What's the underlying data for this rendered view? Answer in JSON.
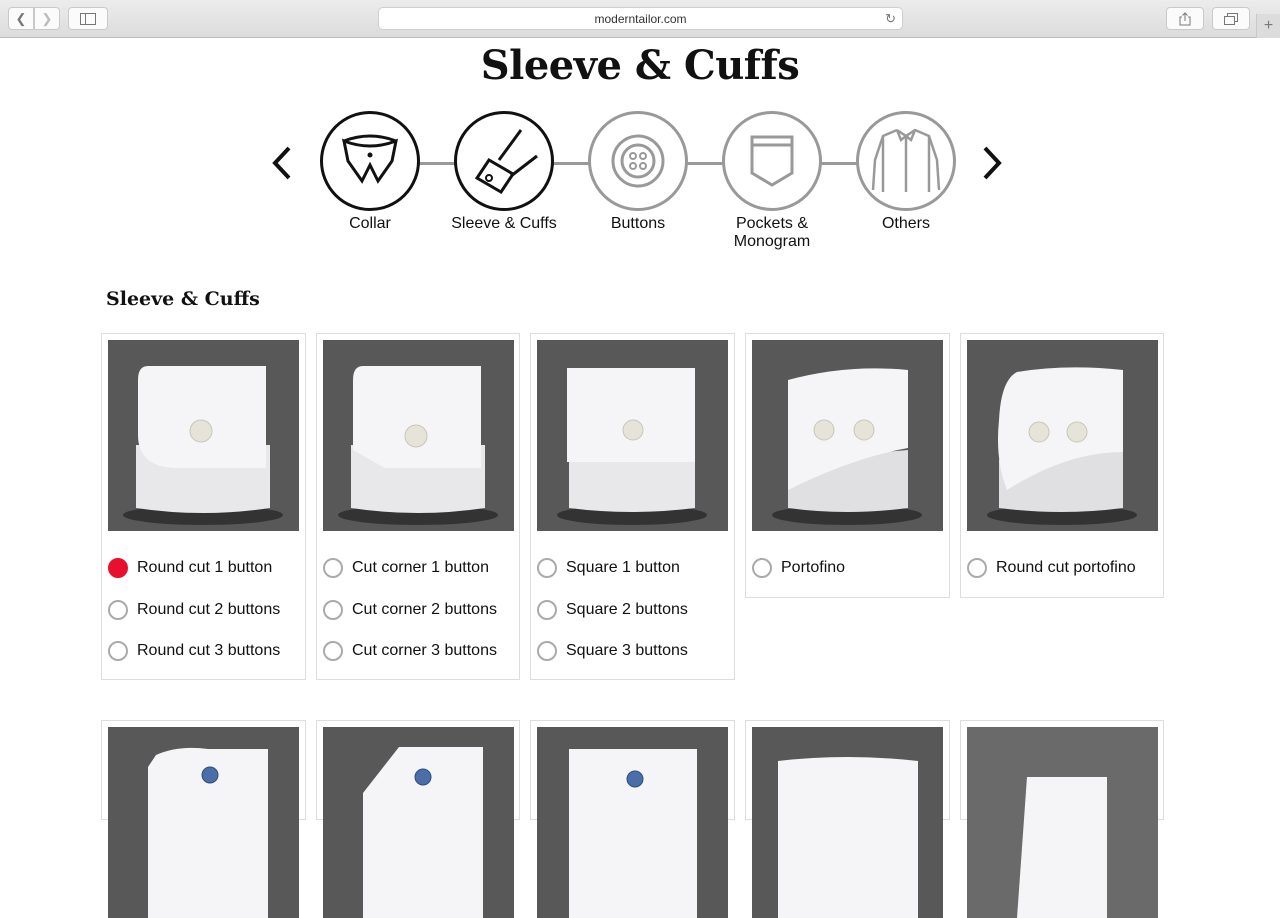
{
  "browser": {
    "url": "moderntailor.com"
  },
  "page": {
    "title": "Sleeve & Cuffs",
    "section_title": "Sleeve & Cuffs"
  },
  "steps": [
    {
      "label": "Collar",
      "active": true
    },
    {
      "label": "Sleeve & Cuffs",
      "active": true
    },
    {
      "label": "Buttons",
      "active": false
    },
    {
      "label": "Pockets & Monogram",
      "active": false
    },
    {
      "label": "Others",
      "active": false
    }
  ],
  "cards": [
    {
      "options": [
        {
          "label": "Round cut 1 button",
          "selected": true
        },
        {
          "label": "Round cut 2 buttons",
          "selected": false
        },
        {
          "label": "Round cut 3 buttons",
          "selected": false
        }
      ]
    },
    {
      "options": [
        {
          "label": "Cut corner 1 button",
          "selected": false
        },
        {
          "label": "Cut corner 2 buttons",
          "selected": false
        },
        {
          "label": "Cut corner 3 buttons",
          "selected": false
        }
      ]
    },
    {
      "options": [
        {
          "label": "Square 1 button",
          "selected": false
        },
        {
          "label": "Square 2 buttons",
          "selected": false
        },
        {
          "label": "Square 3 buttons",
          "selected": false
        }
      ]
    },
    {
      "options": [
        {
          "label": "Portofino",
          "selected": false
        }
      ]
    },
    {
      "options": [
        {
          "label": "Round cut portofino",
          "selected": false
        }
      ]
    }
  ],
  "colors": {
    "selected_radio": "#e8102f",
    "photo_background": "#5b5b5b"
  }
}
